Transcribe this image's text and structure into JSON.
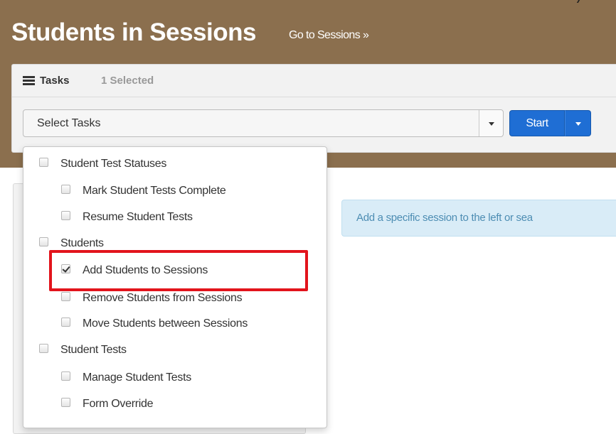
{
  "page": {
    "title": "Students in Sessions",
    "goto_link": "Go to Sessions »"
  },
  "tasks": {
    "label": "Tasks",
    "selected_count": "1 Selected",
    "icon": "list-icon",
    "select_value": "Select Tasks",
    "start_label": "Start"
  },
  "info": {
    "message": "Add a specific session to the left or sea"
  },
  "dropdown": {
    "groups": [
      {
        "label": "Student Test Statuses",
        "checked": false,
        "items": [
          {
            "label": "Mark Student Tests Complete",
            "checked": false
          },
          {
            "label": "Resume Student Tests",
            "checked": false
          }
        ]
      },
      {
        "label": "Students",
        "checked": false,
        "items": [
          {
            "label": "Add Students to Sessions",
            "checked": true
          },
          {
            "label": "Remove Students from Sessions",
            "checked": false
          },
          {
            "label": "Move Students between Sessions",
            "checked": false
          }
        ]
      },
      {
        "label": "Student Tests",
        "checked": false,
        "items": [
          {
            "label": "Manage Student Tests",
            "checked": false
          },
          {
            "label": "Form Override",
            "checked": false
          }
        ]
      }
    ]
  },
  "colors": {
    "header_brown": "#8b6f4e",
    "primary_blue": "#1f6ed4",
    "info_bg": "#d9ecf7",
    "highlight_red": "#e2141c"
  }
}
